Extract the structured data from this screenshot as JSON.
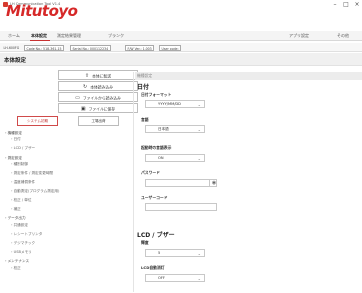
{
  "window": {
    "title": "LH Communication Tool V1.4",
    "controls": [
      "–",
      "□",
      "×"
    ]
  },
  "brand": {
    "logo": "Mitutoyo",
    "color": "#d62828"
  },
  "tabs": [
    {
      "label": "ホーム"
    },
    {
      "label": "本体設定"
    },
    {
      "label": "測定結果管理"
    },
    {
      "label": "ブランク"
    },
    {
      "label": "アプリ設定"
    },
    {
      "label": "その他"
    }
  ],
  "info": {
    "model": "LH-600FG",
    "code": "Code No.: 518-361-15",
    "serial": "Serial No.: 000112234",
    "fw": "F/W Ver.: 1.003",
    "user": "User code:"
  },
  "page_title": "本体設定",
  "actions": [
    {
      "icon": "⇪",
      "label": "本体に転送"
    },
    {
      "icon": "↻",
      "label": "本体読み込み"
    },
    {
      "icon": "▭",
      "label": "ファイルから読み込み"
    },
    {
      "icon": "▣",
      "label": "ファイルに保存"
    }
  ],
  "reset_label": "システム初期",
  "default_label": "工場出荷",
  "nav": [
    {
      "label": "・機種設定",
      "sub": false
    },
    {
      "label": "・日付",
      "sub": true
    },
    {
      "label": "・LCD / ブザー",
      "sub": true
    },
    {
      "label": "・測定設定",
      "sub": false
    },
    {
      "label": "・種別制御",
      "sub": true
    },
    {
      "label": "・測定条件 / 測定変更時間",
      "sub": true
    },
    {
      "label": "・温度補償条件",
      "sub": true
    },
    {
      "label": "・自動測定(プログラム測定用)",
      "sub": true
    },
    {
      "label": "・校正 / 単位",
      "sub": true
    },
    {
      "label": "・補正",
      "sub": true
    },
    {
      "label": "・データ出力",
      "sub": false
    },
    {
      "label": "・共通設定",
      "sub": true
    },
    {
      "label": "・レシートプリンタ",
      "sub": true
    },
    {
      "label": "・デジマチック",
      "sub": true
    },
    {
      "label": "・USBメモリ",
      "sub": true
    },
    {
      "label": "・メンテナンス",
      "sub": false
    },
    {
      "label": "・校正",
      "sub": true
    }
  ],
  "panel": {
    "header": "機種設定",
    "date_heading": "日付",
    "date_format_label": "日付フォーマット",
    "date_format_value": "YYYY/MM/DD",
    "language_label": "言語",
    "language_value": "日本語",
    "startup_label": "起動時の言語表示",
    "startup_value": "ON",
    "password_label": "パスワード",
    "username_label": "ユーザーコード",
    "lcd_heading": "LCD / ブザー",
    "brightness_label": "輝度",
    "brightness_value": "5",
    "backlight_label": "LCD自動消灯",
    "backlight_value": "OFF"
  },
  "colors": {
    "accent": "#c83232",
    "panel_header": "#ececec"
  }
}
